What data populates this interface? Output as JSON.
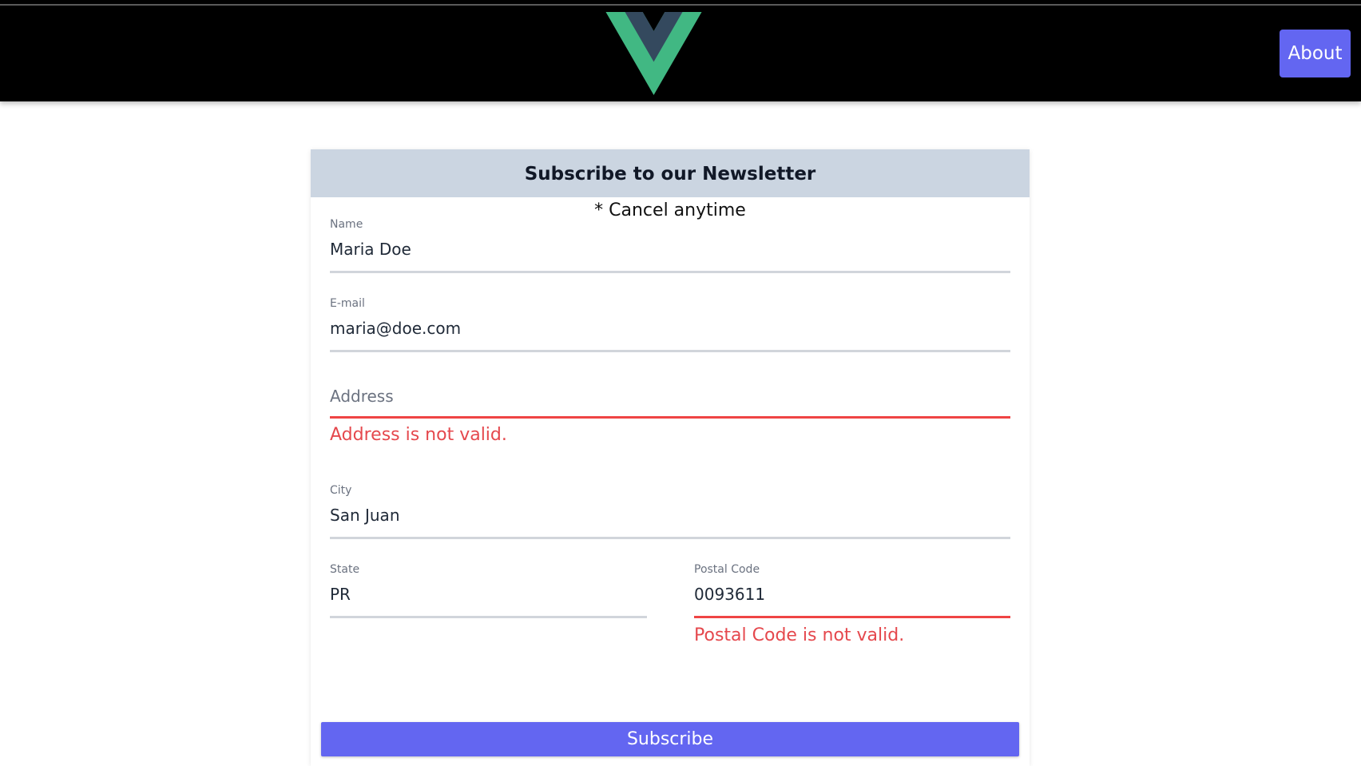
{
  "nav": {
    "about_label": "About",
    "logo_icon": "vue-logo-icon"
  },
  "form": {
    "title": "Subscribe to our Newsletter",
    "subtitle": "* Cancel anytime",
    "name": {
      "label": "Name",
      "value": "Maria Doe"
    },
    "email": {
      "label": "E-mail",
      "value": "maria@doe.com"
    },
    "address": {
      "placeholder": "Address",
      "value": "",
      "error": "Address is not valid."
    },
    "city": {
      "label": "City",
      "value": "San Juan"
    },
    "state": {
      "label": "State",
      "value": "PR"
    },
    "postal_code": {
      "label": "Postal Code",
      "value": "0093611",
      "error": "Postal Code is not valid."
    },
    "submit_label": "Subscribe"
  },
  "colors": {
    "accent": "#6366f1",
    "header_bg": "#cbd5e1",
    "error": "#ef4444",
    "vue_green": "#42b883",
    "vue_dark": "#35495e"
  }
}
